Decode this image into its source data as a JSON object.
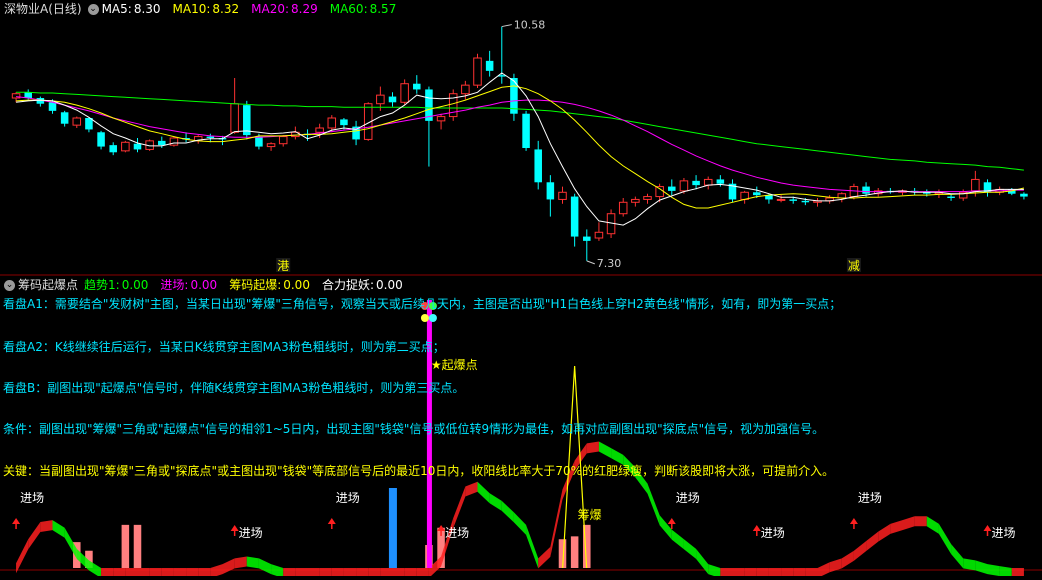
{
  "main_panel": {
    "title": "深物业A(日线)",
    "ma": [
      {
        "label": "MA5:",
        "value": "8.30",
        "color": "#ffffff"
      },
      {
        "label": "MA10:",
        "value": "8.32",
        "color": "#ffff00"
      },
      {
        "label": "MA20:",
        "value": "8.29",
        "color": "#ff00ff"
      },
      {
        "label": "MA60:",
        "value": "8.57",
        "color": "#00ff00"
      }
    ],
    "high_label": "10.58",
    "low_label": "7.30",
    "marker_left": "港",
    "marker_right": "减"
  },
  "sub_panel": {
    "title": "筹码起爆点",
    "indicators": [
      {
        "label": "趋势1:",
        "value": "0.00",
        "color": "#00ff00"
      },
      {
        "label": "进场:",
        "value": "0.00",
        "color": "#ff00ff"
      },
      {
        "label": "筹码起爆:",
        "value": "0.00",
        "color": "#ffff00"
      },
      {
        "label": "合力捉妖:",
        "value": "0.00",
        "color": "#ffffff"
      }
    ],
    "notes": [
      {
        "text": "看盘A1：需要结合\"发财树\"主图，当某日出现\"筹爆\"三角信号，观察当天或后续几天内，主图是否出现\"H1白色线上穿H2黄色线\"情形，如有，即为第一买点；",
        "color": "#00e5ff"
      },
      {
        "text": "看盘A2：K线继续往后运行，当某日K线贯穿主图MA3粉色粗线时，则为第二买点；",
        "color": "#00e5ff"
      },
      {
        "text": "看盘B：副图出现\"起爆点\"信号时，伴随K线贯穿主图MA3粉色粗线时，则为第三买点。",
        "color": "#00e5ff"
      },
      {
        "text": "条件：副图出现\"筹爆\"三角或\"起爆点\"信号的相邻1~5日内，出现主图\"钱袋\"信号或低位转9情形为最佳，如再对应副图出现\"探底点\"信号，视为加强信号。",
        "color": "#00e5ff"
      },
      {
        "text": "关键：当副图出现\"筹爆\"三角或\"探底点\"或主图出现\"钱袋\"等底部信号后的最近10日内，收阳线比率大于70%的红肥绿瘦，判断该股即将大涨，可提前介入。",
        "color": "#ffff00"
      }
    ],
    "burst_label": "★起爆点",
    "chip_label": "筹爆",
    "entry_label": "进场"
  },
  "colors": {
    "up": "#ff3232",
    "down": "#00ffff",
    "bg": "#000000",
    "grid": "#8b0000"
  },
  "chart_data": [
    {
      "type": "candlestick",
      "title": "深物业A(日线)",
      "x": [
        1,
        2,
        3,
        4,
        5,
        6,
        7,
        8,
        9,
        10,
        11,
        12,
        13,
        14,
        15,
        16,
        17,
        18,
        19,
        20,
        21,
        22,
        23,
        24,
        25,
        26,
        27,
        28,
        29,
        30,
        31,
        32,
        33,
        34,
        35,
        36,
        37,
        38,
        39,
        40,
        41,
        42,
        43,
        44,
        45,
        46,
        47,
        48,
        49,
        50,
        51,
        52,
        53,
        54,
        55,
        56,
        57,
        58,
        59,
        60,
        61,
        62,
        63,
        64,
        65,
        66,
        67,
        68,
        69,
        70,
        71,
        72,
        73,
        74,
        75,
        76,
        77,
        78,
        79,
        80,
        81,
        82,
        83,
        84
      ],
      "ohlc": [
        [
          9.58,
          9.66,
          9.52,
          9.64
        ],
        [
          9.66,
          9.7,
          9.56,
          9.58
        ],
        [
          9.58,
          9.6,
          9.46,
          9.5
        ],
        [
          9.52,
          9.56,
          9.36,
          9.4
        ],
        [
          9.38,
          9.4,
          9.18,
          9.22
        ],
        [
          9.2,
          9.32,
          9.16,
          9.3
        ],
        [
          9.3,
          9.31,
          9.1,
          9.14
        ],
        [
          9.1,
          9.12,
          8.86,
          8.9
        ],
        [
          8.92,
          8.96,
          8.78,
          8.82
        ],
        [
          8.84,
          8.98,
          8.82,
          8.96
        ],
        [
          8.94,
          9.02,
          8.82,
          8.86
        ],
        [
          8.86,
          9.0,
          8.84,
          8.98
        ],
        [
          8.98,
          9.04,
          8.88,
          8.92
        ],
        [
          8.92,
          9.04,
          8.9,
          9.02
        ],
        [
          9.02,
          9.1,
          8.96,
          9.0
        ],
        [
          8.98,
          9.06,
          8.94,
          9.04
        ],
        [
          9.04,
          9.08,
          8.96,
          9.02
        ],
        [
          9.02,
          9.05,
          8.92,
          9.0
        ],
        [
          9.1,
          9.86,
          9.08,
          9.5
        ],
        [
          9.48,
          9.54,
          9.0,
          9.06
        ],
        [
          9.04,
          9.08,
          8.86,
          8.9
        ],
        [
          8.9,
          8.96,
          8.84,
          8.94
        ],
        [
          8.94,
          9.06,
          8.9,
          9.04
        ],
        [
          9.04,
          9.18,
          9.0,
          9.1
        ],
        [
          9.08,
          9.14,
          8.98,
          9.06
        ],
        [
          9.1,
          9.22,
          9.02,
          9.16
        ],
        [
          9.16,
          9.34,
          9.1,
          9.3
        ],
        [
          9.28,
          9.3,
          9.14,
          9.2
        ],
        [
          9.18,
          9.26,
          8.92,
          9.0
        ],
        [
          9.0,
          9.52,
          8.98,
          9.5
        ],
        [
          9.5,
          9.74,
          9.4,
          9.62
        ],
        [
          9.6,
          9.66,
          9.46,
          9.52
        ],
        [
          9.52,
          9.84,
          9.48,
          9.78
        ],
        [
          9.78,
          9.9,
          9.64,
          9.7
        ],
        [
          9.7,
          9.74,
          8.62,
          9.26
        ],
        [
          9.26,
          9.36,
          9.14,
          9.32
        ],
        [
          9.32,
          9.7,
          9.26,
          9.64
        ],
        [
          9.64,
          9.82,
          9.56,
          9.76
        ],
        [
          9.76,
          10.2,
          9.72,
          10.14
        ],
        [
          10.1,
          10.24,
          9.88,
          9.96
        ],
        [
          9.9,
          10.58,
          9.78,
          9.88
        ],
        [
          9.86,
          9.92,
          9.26,
          9.36
        ],
        [
          9.36,
          9.4,
          8.84,
          8.88
        ],
        [
          8.86,
          8.98,
          8.3,
          8.4
        ],
        [
          8.4,
          8.5,
          7.92,
          8.16
        ],
        [
          8.16,
          8.34,
          8.1,
          8.26
        ],
        [
          8.2,
          8.24,
          7.5,
          7.64
        ],
        [
          7.64,
          7.74,
          7.3,
          7.58
        ],
        [
          7.62,
          7.84,
          7.58,
          7.7
        ],
        [
          7.68,
          8.02,
          7.62,
          7.96
        ],
        [
          7.96,
          8.18,
          7.92,
          8.12
        ],
        [
          8.12,
          8.2,
          8.06,
          8.16
        ],
        [
          8.16,
          8.24,
          8.1,
          8.2
        ],
        [
          8.2,
          8.38,
          8.12,
          8.34
        ],
        [
          8.34,
          8.44,
          8.22,
          8.28
        ],
        [
          8.28,
          8.46,
          8.24,
          8.42
        ],
        [
          8.42,
          8.5,
          8.3,
          8.36
        ],
        [
          8.36,
          8.48,
          8.3,
          8.44
        ],
        [
          8.44,
          8.5,
          8.34,
          8.38
        ],
        [
          8.38,
          8.44,
          8.12,
          8.16
        ],
        [
          8.16,
          8.28,
          8.1,
          8.26
        ],
        [
          8.26,
          8.34,
          8.18,
          8.22
        ],
        [
          8.22,
          8.24,
          8.1,
          8.16
        ],
        [
          8.16,
          8.22,
          8.12,
          8.16
        ],
        [
          8.16,
          8.2,
          8.1,
          8.14
        ],
        [
          8.14,
          8.18,
          8.08,
          8.12
        ],
        [
          8.12,
          8.18,
          8.06,
          8.14
        ],
        [
          8.14,
          8.22,
          8.1,
          8.18
        ],
        [
          8.18,
          8.26,
          8.12,
          8.24
        ],
        [
          8.2,
          8.38,
          8.16,
          8.34
        ],
        [
          8.34,
          8.4,
          8.2,
          8.24
        ],
        [
          8.24,
          8.32,
          8.2,
          8.28
        ],
        [
          8.28,
          8.32,
          8.24,
          8.26
        ],
        [
          8.26,
          8.3,
          8.22,
          8.28
        ],
        [
          8.28,
          8.32,
          8.22,
          8.26
        ],
        [
          8.26,
          8.3,
          8.2,
          8.24
        ],
        [
          8.24,
          8.3,
          8.18,
          8.26
        ],
        [
          8.2,
          8.24,
          8.14,
          8.18
        ],
        [
          8.18,
          8.3,
          8.14,
          8.26
        ],
        [
          8.28,
          8.56,
          8.2,
          8.44
        ],
        [
          8.4,
          8.44,
          8.2,
          8.26
        ],
        [
          8.26,
          8.34,
          8.22,
          8.3
        ],
        [
          8.3,
          8.32,
          8.22,
          8.24
        ],
        [
          8.24,
          8.26,
          8.16,
          8.2
        ]
      ],
      "ma5": [
        9.52,
        9.54,
        9.55,
        9.54,
        9.48,
        9.41,
        9.31,
        9.19,
        9.08,
        9.02,
        8.95,
        8.91,
        8.91,
        8.95,
        8.95,
        8.99,
        9.01,
        9.01,
        9.11,
        9.12,
        9.1,
        9.08,
        9.09,
        9.11,
        9.01,
        9.06,
        9.13,
        9.16,
        9.14,
        9.23,
        9.32,
        9.37,
        9.48,
        9.62,
        9.58,
        9.57,
        9.58,
        9.61,
        9.66,
        9.8,
        9.93,
        9.82,
        9.61,
        9.32,
        8.94,
        8.62,
        8.31,
        8.06,
        7.86,
        7.83,
        7.8,
        7.89,
        8.03,
        8.15,
        8.21,
        8.27,
        8.31,
        8.36,
        8.37,
        8.35,
        8.32,
        8.29,
        8.24,
        8.19,
        8.19,
        8.16,
        8.14,
        8.14,
        8.16,
        8.2,
        8.22,
        8.25,
        8.27,
        8.28,
        8.26,
        8.26,
        8.26,
        8.24,
        8.24,
        8.27,
        8.28,
        8.3,
        8.3,
        8.3
      ],
      "ma10": [
        9.54,
        9.55,
        9.55,
        9.54,
        9.52,
        9.48,
        9.43,
        9.37,
        9.3,
        9.24,
        9.18,
        9.12,
        9.08,
        9.04,
        9.0,
        8.98,
        8.97,
        8.97,
        8.99,
        9.01,
        9.05,
        9.05,
        9.05,
        9.06,
        9.07,
        9.07,
        9.08,
        9.1,
        9.12,
        9.15,
        9.2,
        9.25,
        9.3,
        9.36,
        9.42,
        9.46,
        9.5,
        9.55,
        9.61,
        9.67,
        9.73,
        9.75,
        9.71,
        9.64,
        9.54,
        9.42,
        9.27,
        9.1,
        8.92,
        8.76,
        8.63,
        8.52,
        8.41,
        8.31,
        8.19,
        8.09,
        8.04,
        8.04,
        8.08,
        8.12,
        8.16,
        8.2,
        8.22,
        8.23,
        8.24,
        8.23,
        8.21,
        8.19,
        8.18,
        8.18,
        8.19,
        8.19,
        8.2,
        8.21,
        8.22,
        8.22,
        8.23,
        8.23,
        8.24,
        8.25,
        8.26,
        8.26,
        8.28,
        8.32
      ],
      "ma20": [
        9.6,
        9.58,
        9.55,
        9.52,
        9.48,
        9.44,
        9.4,
        9.35,
        9.3,
        9.26,
        9.22,
        9.18,
        9.15,
        9.12,
        9.09,
        9.07,
        9.05,
        9.04,
        9.03,
        9.03,
        9.03,
        9.04,
        9.05,
        9.06,
        9.07,
        9.09,
        9.11,
        9.13,
        9.15,
        9.17,
        9.2,
        9.23,
        9.26,
        9.29,
        9.32,
        9.35,
        9.38,
        9.41,
        9.45,
        9.48,
        9.52,
        9.54,
        9.55,
        9.55,
        9.54,
        9.52,
        9.49,
        9.45,
        9.4,
        9.34,
        9.27,
        9.19,
        9.11,
        9.02,
        8.93,
        8.85,
        8.77,
        8.7,
        8.63,
        8.57,
        8.52,
        8.47,
        8.43,
        8.39,
        8.36,
        8.34,
        8.32,
        8.3,
        8.29,
        8.28,
        8.27,
        8.27,
        8.27,
        8.27,
        8.27,
        8.27,
        8.27,
        8.27,
        8.27,
        8.28,
        8.28,
        8.28,
        8.29,
        8.29
      ],
      "ma60": [
        9.66,
        9.66,
        9.65,
        9.65,
        9.64,
        9.63,
        9.62,
        9.61,
        9.6,
        9.59,
        9.58,
        9.57,
        9.56,
        9.55,
        9.54,
        9.53,
        9.52,
        9.51,
        9.5,
        9.49,
        9.48,
        9.48,
        9.47,
        9.47,
        9.46,
        9.46,
        9.46,
        9.45,
        9.45,
        9.45,
        9.45,
        9.45,
        9.45,
        9.45,
        9.44,
        9.44,
        9.44,
        9.44,
        9.44,
        9.44,
        9.44,
        9.43,
        9.42,
        9.41,
        9.4,
        9.38,
        9.36,
        9.34,
        9.32,
        9.3,
        9.27,
        9.24,
        9.21,
        9.18,
        9.15,
        9.12,
        9.09,
        9.06,
        9.03,
        9.0,
        8.97,
        8.94,
        8.92,
        8.9,
        8.88,
        8.86,
        8.84,
        8.82,
        8.8,
        8.78,
        8.76,
        8.74,
        8.72,
        8.71,
        8.7,
        8.68,
        8.67,
        8.66,
        8.65,
        8.64,
        8.62,
        8.61,
        8.59,
        8.57
      ],
      "ylim": [
        7.2,
        10.7
      ],
      "annotations": [
        {
          "x": 41,
          "text": "10.58"
        },
        {
          "x": 48,
          "text": "7.30"
        }
      ]
    },
    {
      "type": "indicator",
      "title": "筹码起爆点",
      "x": [
        1,
        2,
        3,
        4,
        5,
        6,
        7,
        8,
        9,
        10,
        11,
        12,
        13,
        14,
        15,
        16,
        17,
        18,
        19,
        20,
        21,
        22,
        23,
        24,
        25,
        26,
        27,
        28,
        29,
        30,
        31,
        32,
        33,
        34,
        35,
        36,
        37,
        38,
        39,
        40,
        41,
        42,
        43,
        44,
        45,
        46,
        47,
        48,
        49,
        50,
        51,
        52,
        53,
        54,
        55,
        56,
        57,
        58,
        59,
        60,
        61,
        62,
        63,
        64,
        65,
        66,
        67,
        68,
        69,
        70,
        71,
        72,
        73,
        74,
        75,
        76,
        77,
        78,
        79,
        80,
        81,
        82,
        83,
        84
      ],
      "trend1": [
        5,
        30,
        48,
        50,
        42,
        20,
        8,
        0,
        0,
        0,
        0,
        0,
        0,
        0,
        0,
        0,
        0,
        4,
        10,
        12,
        10,
        4,
        0,
        0,
        0,
        0,
        0,
        0,
        0,
        0,
        0,
        0,
        0,
        0,
        0,
        12,
        52,
        85,
        90,
        78,
        70,
        58,
        45,
        10,
        22,
        82,
        112,
        130,
        132,
        125,
        118,
        105,
        88,
        55,
        40,
        30,
        20,
        4,
        0,
        0,
        0,
        0,
        0,
        0,
        0,
        0,
        0,
        6,
        10,
        18,
        28,
        38,
        46,
        50,
        54,
        54,
        46,
        25,
        10,
        8,
        4,
        2,
        0,
        0
      ],
      "chip_bars": [
        0,
        0,
        0,
        0,
        0,
        18,
        12,
        0,
        0,
        30,
        30,
        0,
        0,
        0,
        0,
        0,
        0,
        0,
        0,
        0,
        0,
        0,
        0,
        0,
        0,
        0,
        0,
        0,
        0,
        0,
        0,
        0,
        0,
        0,
        16,
        28,
        0,
        0,
        0,
        0,
        0,
        0,
        0,
        0,
        0,
        20,
        22,
        30,
        0,
        0,
        0,
        0,
        0,
        0,
        0,
        0,
        0,
        0,
        0,
        0,
        0,
        0,
        0,
        0,
        0,
        0,
        0,
        0,
        0,
        0,
        0,
        0,
        0,
        0,
        0,
        0,
        0,
        0,
        0,
        0,
        0,
        0,
        0,
        0
      ],
      "burst_x": 35,
      "chip_x": 47,
      "entry_markers": [
        1,
        19,
        27,
        36,
        55,
        62,
        70,
        81
      ],
      "ylim": [
        0,
        290
      ]
    }
  ]
}
